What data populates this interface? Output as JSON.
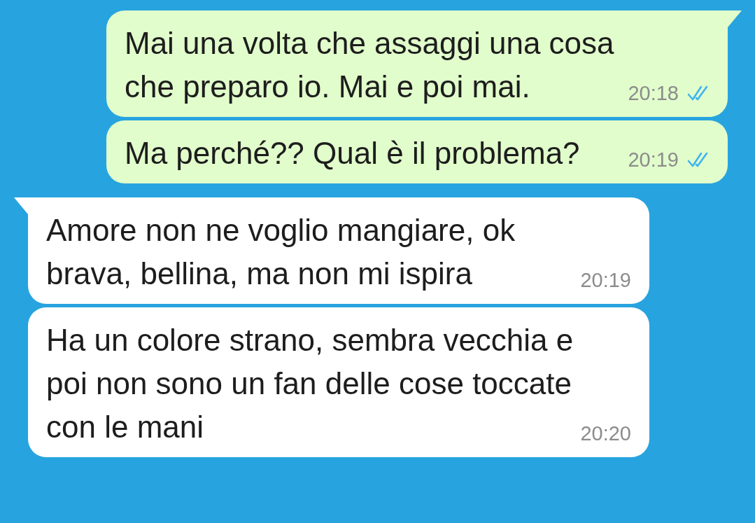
{
  "messages": [
    {
      "kind": "sent",
      "tail": true,
      "lines": [
        "Mai una volta che assaggi una cosa",
        "che preparo io. Mai e poi mai."
      ],
      "time": "20:18",
      "read": true
    },
    {
      "kind": "sent",
      "tail": false,
      "lines": [
        "Ma perché?? Qual è il problema?"
      ],
      "time": "20:19",
      "read": true
    },
    {
      "kind": "received",
      "tail": true,
      "lines": [
        "Amore non ne voglio mangiare, ok",
        "brava, bellina, ma non mi ispira"
      ],
      "time": "20:19"
    },
    {
      "kind": "received",
      "tail": false,
      "lines": [
        "Ha un colore strano, sembra vecchia e",
        "poi non sono un fan delle cose toccate",
        "con le mani"
      ],
      "time": "20:20"
    }
  ]
}
